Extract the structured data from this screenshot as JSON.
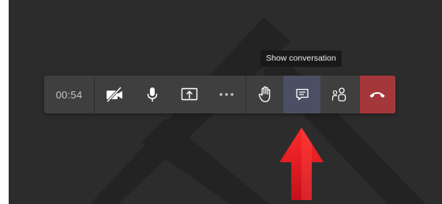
{
  "call": {
    "timer": "00:54",
    "tooltip": "Show conversation"
  },
  "buttons": [
    {
      "id": "camera-off",
      "icon": "video-off-icon"
    },
    {
      "id": "microphone",
      "icon": "microphone-icon"
    },
    {
      "id": "share",
      "icon": "share-screen-icon"
    },
    {
      "id": "more",
      "icon": "more-actions-icon"
    },
    {
      "id": "raise-hand",
      "icon": "raise-hand-icon"
    },
    {
      "id": "conversation",
      "icon": "chat-icon",
      "active": true
    },
    {
      "id": "participants",
      "icon": "people-icon"
    },
    {
      "id": "hang-up",
      "icon": "phone-hangup-icon"
    }
  ],
  "colors": {
    "background": "#2d2c2c",
    "toolbar": "#403f3f",
    "active_button": "#4b4f63",
    "hangup": "#a4373a",
    "tooltip": "#191919",
    "annotation_arrow": "#e3121b"
  }
}
